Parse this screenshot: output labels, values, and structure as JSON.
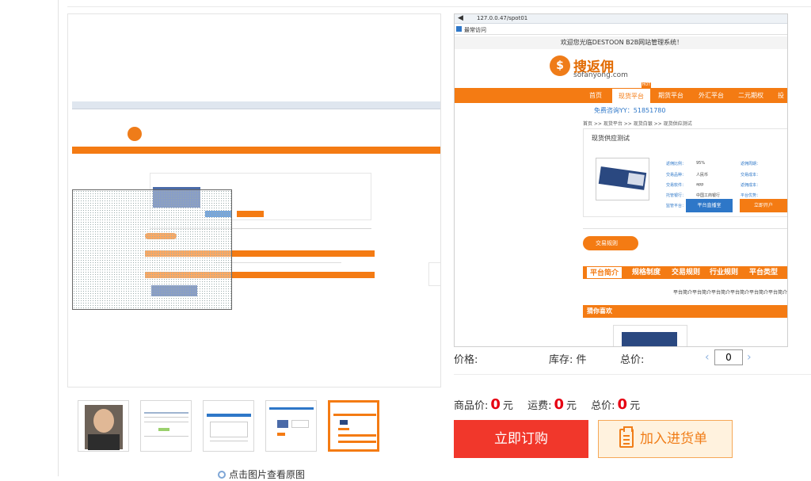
{
  "preview": {
    "url": "127.0.0.47/spot01",
    "favorites": "最常访问",
    "welcome": "欢迎您光临DESTOON B2B网站管理系统！",
    "logo_mark": "$",
    "logo_cn": "搜返佣",
    "logo_en": "sofanyong.com",
    "hot_badge": "HOT",
    "nav": [
      "首页",
      "现货平台",
      "期货平台",
      "外汇平台",
      "二元期权",
      "投资"
    ],
    "free_line": "免费咨询YY：51851780",
    "breadcrumb": "首页 >> 现货平台 >> 现货白银 >> 现货供应测试",
    "card_title": "现货供应测试",
    "fields_left": [
      {
        "k": "返佣比例：",
        "v": "95%"
      },
      {
        "k": "交易品种：",
        "v": "人民币"
      },
      {
        "k": "交易软件：",
        "v": "app"
      },
      {
        "k": "托管银行：",
        "v": "中国工商银行"
      },
      {
        "k": "监管平台：",
        "v": "windos"
      }
    ],
    "fields_right": [
      "返佣周期：",
      "交易成本：",
      "返佣成本：",
      "平台优势："
    ],
    "btn_live": "平台直播室",
    "btn_open": "立即开户",
    "pill": "交易规则",
    "tabs": [
      "平台简介",
      "规格制度",
      "交易规则",
      "行业规则",
      "平台类型"
    ],
    "intro_text": "平台简介平台简介平台简介平台简介平台简介平台简介",
    "guess": "猜你喜欢"
  },
  "buy": {
    "price_label": "价格:",
    "stock_label": "库存: 件",
    "total_label": "总价:",
    "qty_value": "0",
    "qty_prev": "‹",
    "qty_next": "›",
    "goods_label": "商品价:",
    "goods_value": "0",
    "yuan": "元",
    "ship_label": "运费:",
    "ship_value": "0",
    "sum_label": "总价:",
    "sum_value": "0",
    "order_btn": "立即订购",
    "cart_btn": "加入进货单"
  },
  "gallery": {
    "hint": "点击图片查看原图"
  },
  "colors": {
    "brand_orange": "#f47b13",
    "buy_red": "#f1372b",
    "price_red": "#e60012",
    "link_blue": "#2e77c8"
  },
  "icons": [
    "magnifier-icon",
    "clipboard-icon",
    "chevron-left-icon",
    "chevron-right-icon",
    "back-arrow-icon"
  ]
}
